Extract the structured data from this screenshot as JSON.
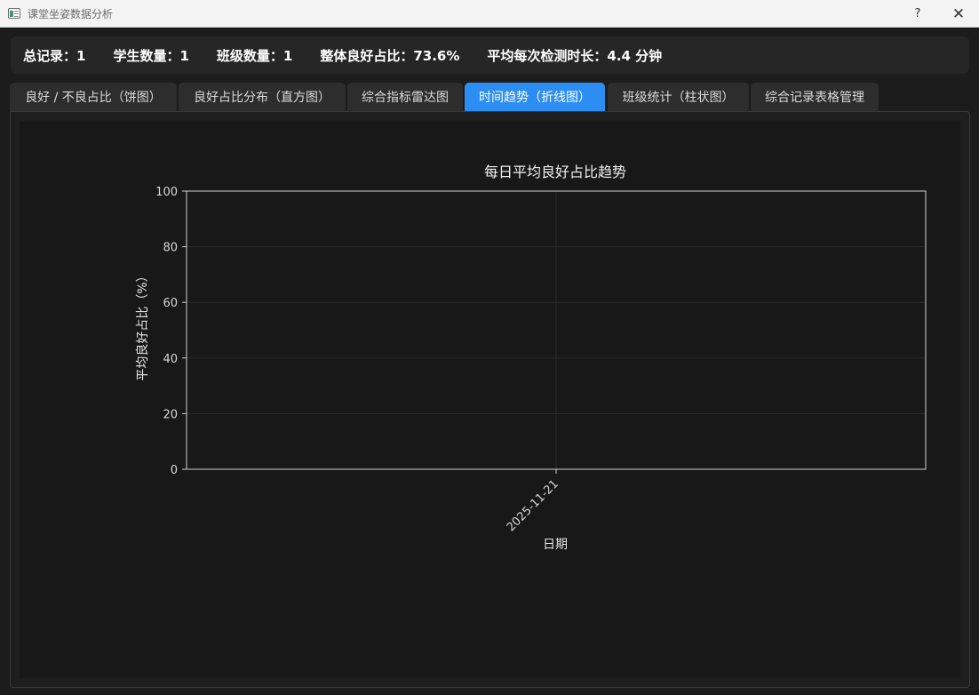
{
  "window": {
    "title": "课堂坐姿数据分析",
    "help_label": "?",
    "close_label": "✕"
  },
  "stats": [
    "总记录：1",
    "学生数量：1",
    "班级数量：1",
    "整体良好占比：73.6%",
    "平均每次检测时长：4.4 分钟"
  ],
  "tabs": [
    {
      "label": "良好 / 不良占比（饼图）",
      "active": false
    },
    {
      "label": "良好占比分布（直方图）",
      "active": false
    },
    {
      "label": "综合指标雷达图",
      "active": false
    },
    {
      "label": "时间趋势（折线图）",
      "active": true
    },
    {
      "label": "班级统计（柱状图）",
      "active": false
    },
    {
      "label": "综合记录表格管理",
      "active": false
    }
  ],
  "colors": {
    "accent": "#2c8df2",
    "background": "#181818",
    "axis": "#cfcfcf",
    "grid": "#2c2c2c"
  },
  "chart_data": {
    "type": "line",
    "title": "每日平均良好占比趋势",
    "xlabel": "日期",
    "ylabel": "平均良好占比（%）",
    "x": [
      "2025-11-21"
    ],
    "series": [
      {
        "values": []
      }
    ],
    "ylim": [
      0,
      100
    ],
    "yticks": [
      0,
      20,
      40,
      60,
      80,
      100
    ],
    "xtick_rotation": 45,
    "grid": true
  }
}
